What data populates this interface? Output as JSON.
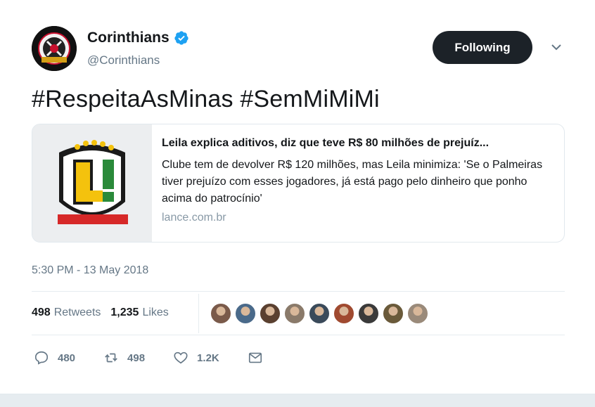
{
  "user": {
    "name": "Corinthians",
    "handle": "@Corinthians",
    "verified": true
  },
  "follow_button": {
    "label": "Following"
  },
  "tweet": {
    "text": "#RespeitaAsMinas #SemMiMiMi"
  },
  "card": {
    "image_icon": "lance-logo",
    "title": "Leila explica aditivos, diz que teve R$ 80 milhões de prejuíz...",
    "description": "Clube tem de devolver R$ 120 milhões, mas Leila minimiza: 'Se o Palmeiras tiver prejuízo com esses jogadores, já está pago pelo dinheiro que ponho acima do patrocínio'",
    "domain": "lance.com.br"
  },
  "timestamp": "5:30 PM - 13 May 2018",
  "stats": {
    "retweets_count": "498",
    "retweets_label": "Retweets",
    "likes_count": "1,235",
    "likes_label": "Likes"
  },
  "liker_avatars": [
    "#7a5a4a",
    "#4a6a8a",
    "#5a4030",
    "#8a7a6a",
    "#3a4a5a",
    "#a04a30",
    "#3a3a3a",
    "#6a5a3a",
    "#9a8a7a"
  ],
  "actions": {
    "reply_count": "480",
    "retweet_count": "498",
    "like_count": "1.2K"
  },
  "colors": {
    "accent": "#1da1f2",
    "text_secondary": "#657786",
    "follow_bg": "#1c2228"
  }
}
